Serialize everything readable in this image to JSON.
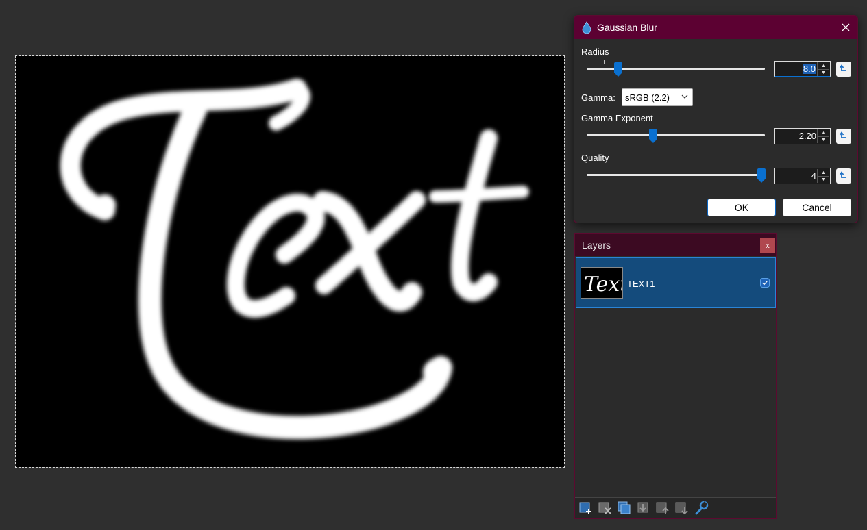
{
  "canvas": {
    "text": "Text"
  },
  "dialog": {
    "title": "Gaussian Blur",
    "title_icon": "droplet-icon",
    "radius": {
      "label": "Radius",
      "value": "8.0",
      "level_fraction": 0.176
    },
    "gamma": {
      "label": "Gamma:",
      "selected": "sRGB (2.2)"
    },
    "gamma_exponent": {
      "label": "Gamma Exponent",
      "value": "2.20",
      "level_fraction": 0.372
    },
    "quality": {
      "label": "Quality",
      "value": "4",
      "level_fraction": 0.98
    },
    "ok_label": "OK",
    "cancel_label": "Cancel"
  },
  "layers": {
    "title": "Layers",
    "close_label": "x",
    "items": [
      {
        "name": "TEXT1",
        "thumb_text": "Text",
        "visible": true
      }
    ],
    "toolbar": [
      "add-layer-icon",
      "delete-layer-icon",
      "duplicate-layer-icon",
      "merge-layer-down-icon",
      "move-layer-up-icon",
      "move-layer-down-icon",
      "layer-properties-icon"
    ]
  },
  "colors": {
    "titlebar": "#5c0132",
    "accent": "#0a70d0",
    "selection": "#144b7c"
  }
}
